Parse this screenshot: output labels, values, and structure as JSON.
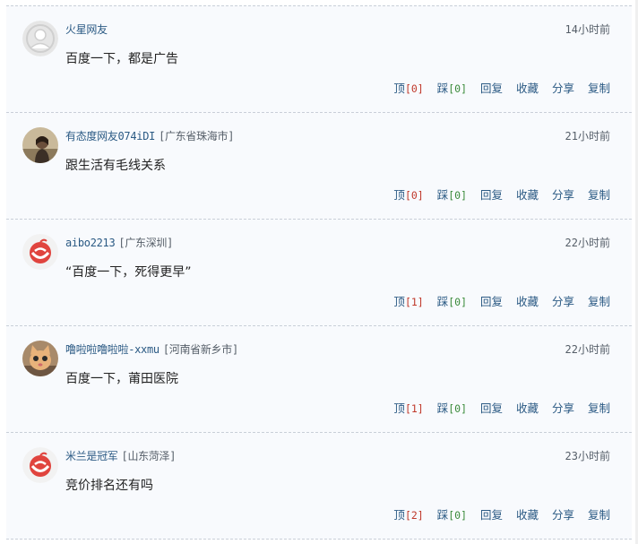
{
  "comments": [
    {
      "avatar": "default-user-avatar",
      "username": "火星网友",
      "location": "",
      "time": "14小时前",
      "content": "百度一下，都是广告",
      "up_label": "顶",
      "up_count": "[0]",
      "down_label": "踩",
      "down_count": "[0]",
      "reply": "回复",
      "favorite": "收藏",
      "share": "分享",
      "copy": "复制"
    },
    {
      "avatar": "photo-avatar-woman",
      "username": "有态度网友074iDI",
      "location": "[广东省珠海市]",
      "time": "21小时前",
      "content": "跟生活有毛线关系",
      "up_label": "顶",
      "up_count": "[0]",
      "down_label": "踩",
      "down_count": "[0]",
      "reply": "回复",
      "favorite": "收藏",
      "share": "分享",
      "copy": "复制"
    },
    {
      "avatar": "netease-logo-avatar",
      "username": "aibo2213",
      "location": "[广东深圳]",
      "time": "22小时前",
      "content": "“百度一下，死得更早”",
      "up_label": "顶",
      "up_count": "[1]",
      "down_label": "踩",
      "down_count": "[0]",
      "reply": "回复",
      "favorite": "收藏",
      "share": "分享",
      "copy": "复制"
    },
    {
      "avatar": "photo-avatar-cat",
      "username": "噜啦啦噜啦啦-xxmu",
      "location": "[河南省新乡市]",
      "time": "22小时前",
      "content": "百度一下，莆田医院",
      "up_label": "顶",
      "up_count": "[1]",
      "down_label": "踩",
      "down_count": "[0]",
      "reply": "回复",
      "favorite": "收藏",
      "share": "分享",
      "copy": "复制"
    },
    {
      "avatar": "netease-logo-avatar",
      "username": "米兰是冠军",
      "location": "[山东菏泽]",
      "time": "23小时前",
      "content": "竞价排名还有吗",
      "up_label": "顶",
      "up_count": "[2]",
      "down_label": "踩",
      "down_count": "[0]",
      "reply": "回复",
      "favorite": "收藏",
      "share": "分享",
      "copy": "复制"
    }
  ],
  "colors": {
    "link": "#2b5a84",
    "up_count": "#c0392b",
    "down_count": "#3a8a3a",
    "background": "#f8fafd",
    "divider": "#c9cfd8"
  }
}
